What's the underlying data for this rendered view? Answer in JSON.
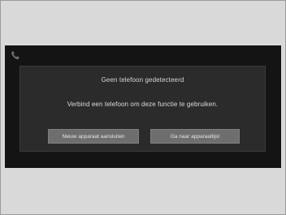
{
  "dialog": {
    "title": "Geen telefoon gedetecteerd",
    "message": "Verbind een telefoon om deze functie te gebruiken.",
    "buttons": [
      {
        "label": "Nieuw apparaat aansluiten"
      },
      {
        "label": "Ga naar apparaatlijst"
      }
    ]
  },
  "icons": {
    "status": "phone-icon"
  },
  "colors": {
    "background": "#d9d9d9",
    "screen": "#141414",
    "dialog": "#2b2b2b",
    "button": "#6e6e6e"
  }
}
